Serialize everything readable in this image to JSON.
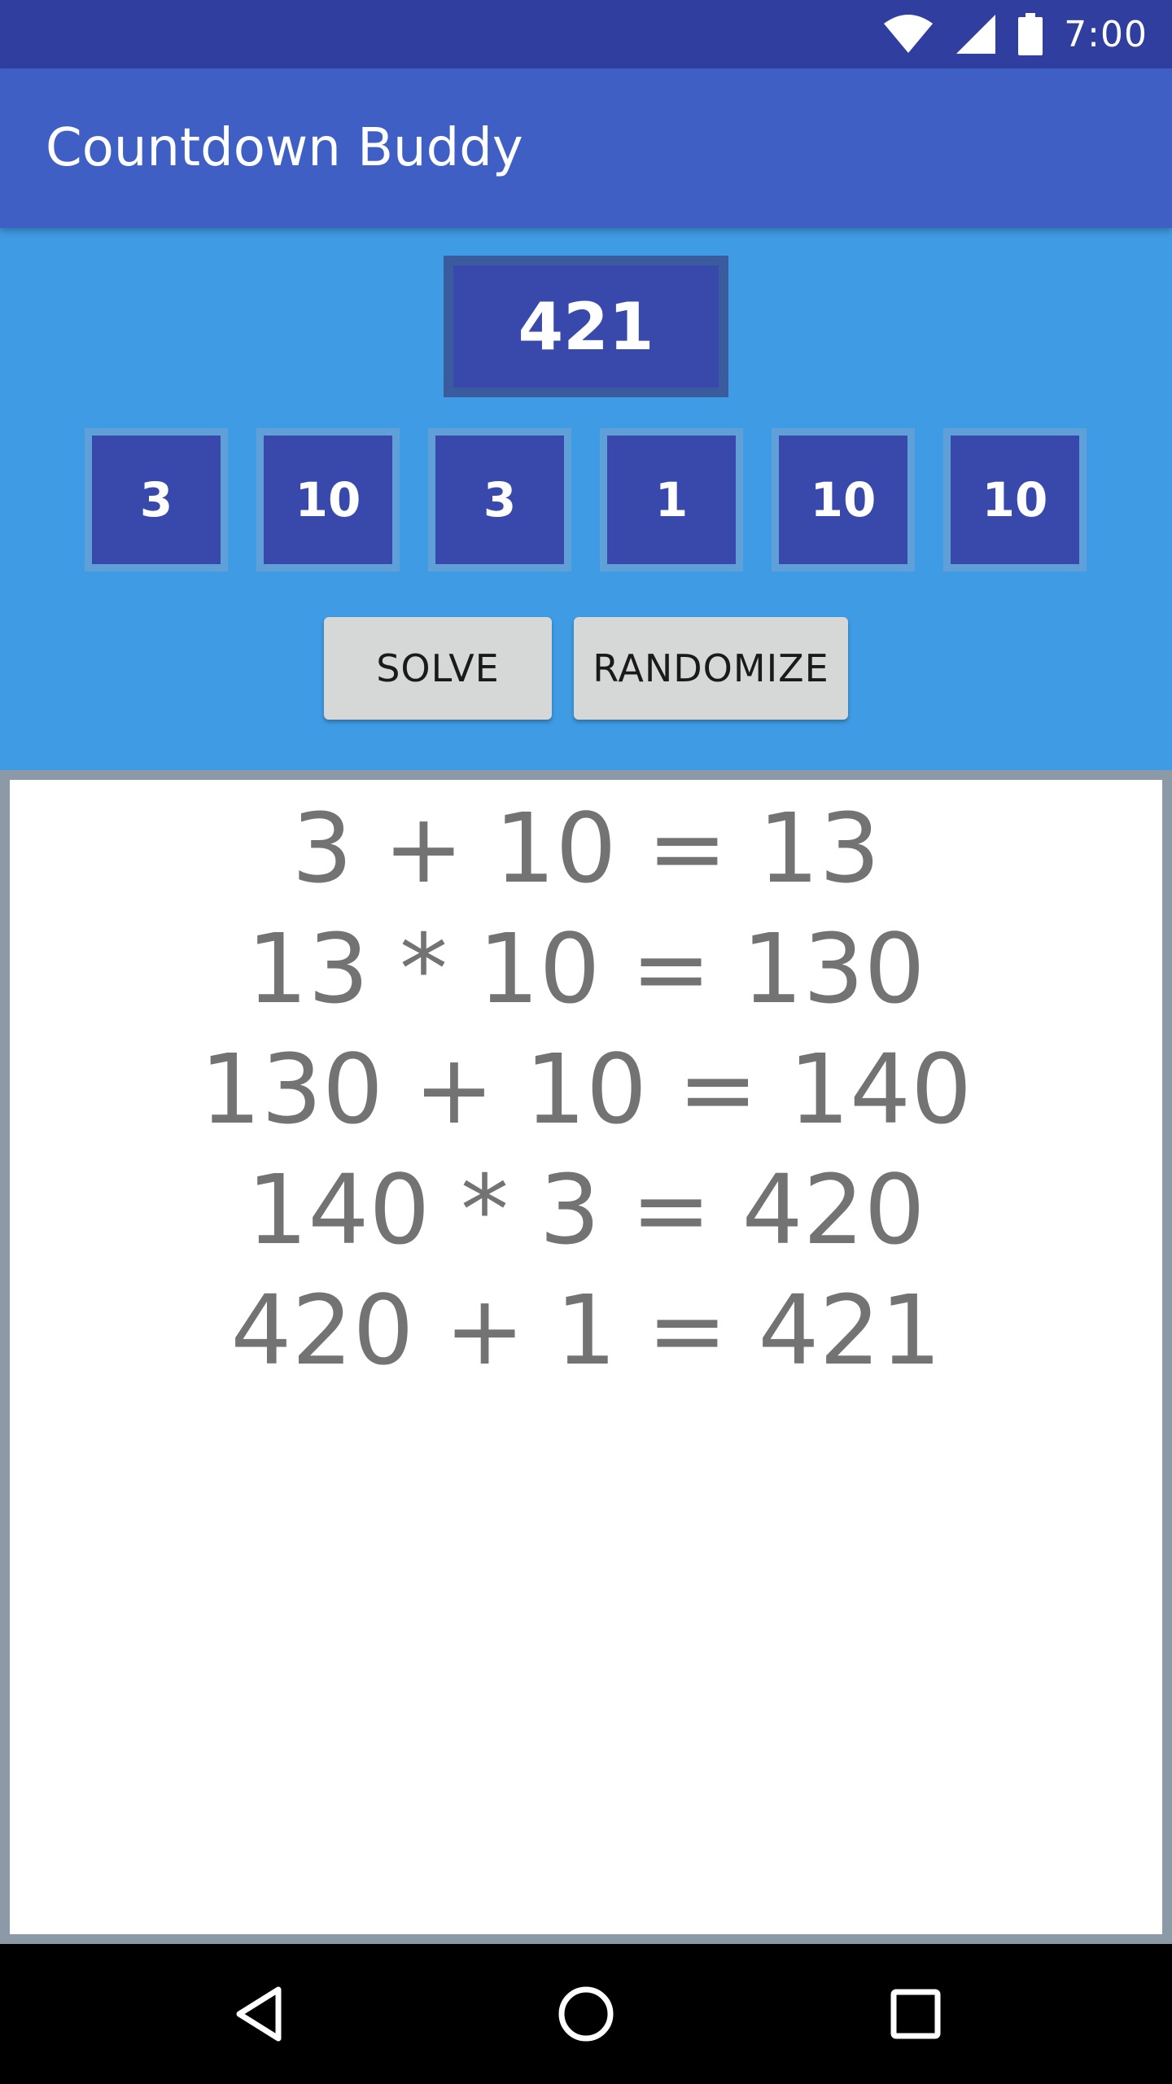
{
  "status_bar": {
    "time": "7:00",
    "icons": [
      "wifi-icon",
      "signal-icon",
      "battery-icon"
    ]
  },
  "app_bar": {
    "title": "Countdown Buddy"
  },
  "target": {
    "value": "421"
  },
  "numbers": [
    "3",
    "10",
    "3",
    "1",
    "10",
    "10"
  ],
  "buttons": {
    "solve": "SOLVE",
    "randomize": "RANDOMIZE"
  },
  "solution": {
    "lines": [
      "3 + 10 = 13",
      "13 * 10 = 130",
      "130 + 10 = 140",
      "140 * 3 = 420",
      "420 + 1 = 421"
    ]
  },
  "nav_bar": {
    "icons": [
      "back-icon",
      "home-icon",
      "recents-icon"
    ]
  },
  "colors": {
    "status_bar": "#303f9f",
    "app_bar": "#3f5fc4",
    "controls_bg": "#3f9be3",
    "tile": "#3949ab",
    "result_text": "#737373"
  }
}
